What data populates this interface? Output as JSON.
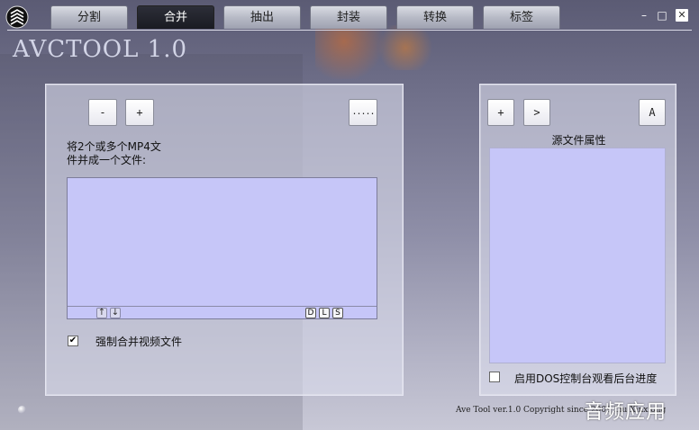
{
  "tabs": [
    {
      "label": "分割",
      "active": false
    },
    {
      "label": "合并",
      "active": true
    },
    {
      "label": "抽出",
      "active": false
    },
    {
      "label": "封装",
      "active": false
    },
    {
      "label": "转换",
      "active": false
    },
    {
      "label": "标签",
      "active": false
    }
  ],
  "window_controls": {
    "minimize": "–",
    "maximize": "□",
    "close": "✕"
  },
  "app_title": "AVCTOOL 1.0",
  "merge_panel": {
    "remove_button": "-",
    "add_button": "+",
    "browse_button": ".....",
    "description": "将2个或多个MP4文件并成一个文件:",
    "move_up": "↑",
    "move_down": "↓",
    "flag_d": "D",
    "flag_l": "L",
    "flag_s": "S",
    "force_merge_checked": true,
    "force_merge_label": "强制合并视频文件"
  },
  "properties_panel": {
    "add_button": "+",
    "next_button": ">",
    "a_button": "A",
    "title": "源文件属性",
    "dos_console_checked": false,
    "dos_console_label": "启用DOS控制台观看后台进度"
  },
  "footer": {
    "version_text": "Ave Tool ver.1.0 Copyright since 2009 Liu Xinxiong",
    "watermark": "音频应用"
  },
  "colors": {
    "active_tab": "#1c1d24",
    "listbox": "#c6c6f8",
    "title": "#d2d4e6"
  }
}
